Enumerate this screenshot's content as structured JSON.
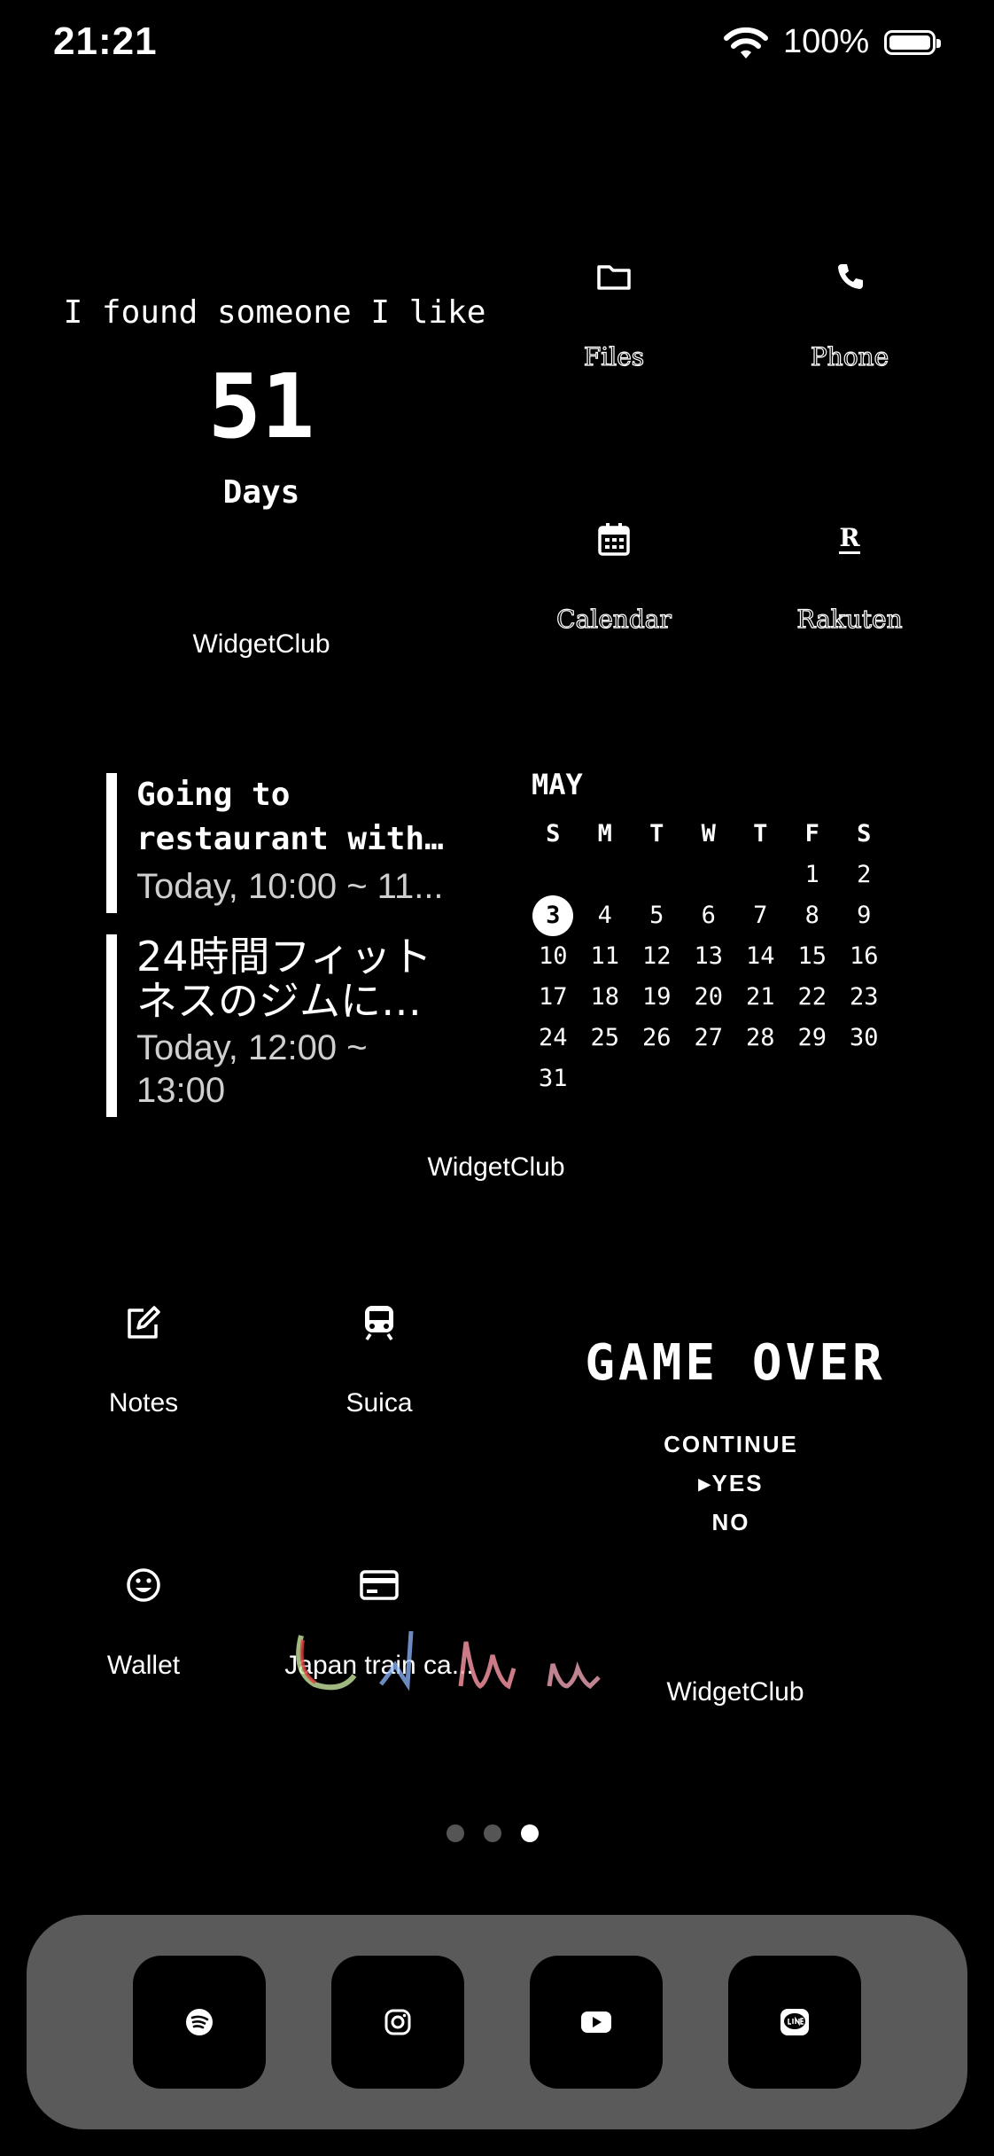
{
  "status_bar": {
    "time": "21:21",
    "battery_percent": "100%",
    "wifi_icon": "wifi-icon",
    "battery_icon": "battery-icon"
  },
  "counter_widget": {
    "caption": "I found someone I like",
    "number": "51",
    "unit": "Days",
    "label": "WidgetClub"
  },
  "apps_top": [
    {
      "label": "Files",
      "icon": "folder-icon"
    },
    {
      "label": "Phone",
      "icon": "phone-icon"
    },
    {
      "label": "Calendar",
      "icon": "calendar-icon"
    },
    {
      "label": "Rakuten",
      "icon": "rakuten-icon",
      "glyph": "R"
    }
  ],
  "events_widget": {
    "events": [
      {
        "title": "Going to restaurant with…",
        "when": "Today, 10:00 ~ 11..."
      },
      {
        "title": "24時間フィットネスのジムに…",
        "when_line1": "Today, 12:00 ~",
        "when_line2": "13:00"
      }
    ]
  },
  "calendar_widget": {
    "month": "MAY",
    "weekdays": [
      "S",
      "M",
      "T",
      "W",
      "T",
      "F",
      "S"
    ],
    "today": 3,
    "weeks": [
      [
        "",
        "",
        "",
        "",
        "",
        "1",
        "2"
      ],
      [
        "3",
        "4",
        "5",
        "6",
        "7",
        "8",
        "9"
      ],
      [
        "10",
        "11",
        "12",
        "13",
        "14",
        "15",
        "16"
      ],
      [
        "17",
        "18",
        "19",
        "20",
        "21",
        "22",
        "23"
      ],
      [
        "24",
        "25",
        "26",
        "27",
        "28",
        "29",
        "30"
      ],
      [
        "31",
        "",
        "",
        "",
        "",
        "",
        ""
      ]
    ],
    "label": "WidgetClub"
  },
  "apps_bottom": [
    {
      "label": "Notes",
      "icon": "pencil-square-icon"
    },
    {
      "label": "Suica",
      "icon": "train-icon"
    },
    {
      "label": "Wallet",
      "icon": "smiley-icon"
    },
    {
      "label": "Japan train ca...",
      "icon": "credit-card-icon"
    }
  ],
  "game_widget": {
    "title": "GAME OVER",
    "prompt": "CONTINUE",
    "yes": "▸YES",
    "no": "NO",
    "label": "WidgetClub"
  },
  "page_indicator": {
    "pages": 3,
    "active": 3
  },
  "dock": [
    {
      "icon": "spotify-icon"
    },
    {
      "icon": "instagram-icon"
    },
    {
      "icon": "youtube-icon"
    },
    {
      "icon": "line-icon"
    }
  ]
}
